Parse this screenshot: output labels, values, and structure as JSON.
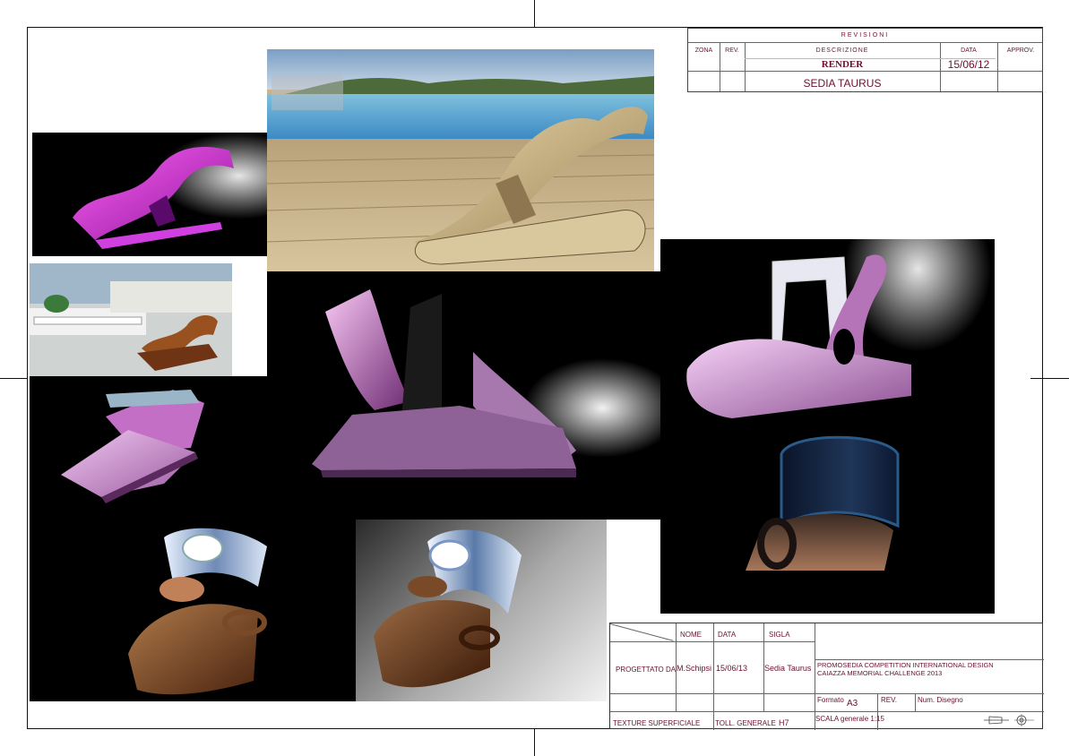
{
  "revisioni": {
    "title": "REVISIONI",
    "headers": {
      "zona": "ZONA",
      "rev": "REV.",
      "descrizione": "DESCRIZIONE",
      "data": "DATA",
      "approv": "APPROV."
    },
    "row1": {
      "descrizione": "RENDER",
      "data": "15/06/12"
    },
    "row2": {
      "descrizione": "SEDIA TAURUS"
    }
  },
  "title_block": {
    "nome_label": "NOME",
    "data_label": "DATA",
    "sigla_label": "SIGLA",
    "progettato_label": "PROGETTATO DA",
    "nome_value": "M.Schipsi",
    "data_value": "15/06/13",
    "sigla_value": "Sedia Taurus",
    "description_line1": "PROMOSEDIA COMPETITION  INTERNATIONAL DESIGN",
    "description_line2": "CAIAZZA MEMORIAL CHALLENGE 2013",
    "formato_label": "Formato",
    "formato_value": "A3",
    "rev_label": "REV.",
    "num_disegno_label": "Num. Disegno",
    "texture_label": "TEXTURE SUPERFICIALE",
    "toll_label": "TOLL. GENERALE",
    "toll_value": "H7",
    "scala_label": "SCALA generale 1:15"
  },
  "colors": {
    "text_accent": "#6b1030",
    "purple_render": "#c070d0",
    "wood": "#8a4a22"
  }
}
